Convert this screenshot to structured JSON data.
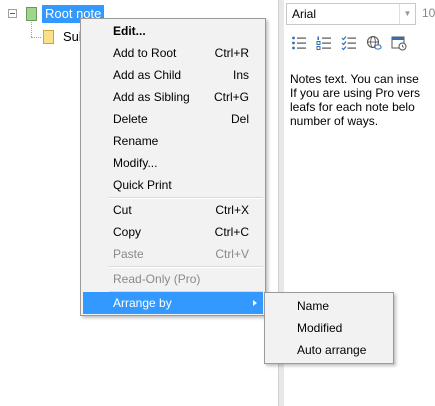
{
  "tree": {
    "nodes": [
      {
        "label": "Root note",
        "icon": "note-icon-green",
        "selected": true
      },
      {
        "label": "Sub",
        "icon": "note-icon-yellow",
        "selected": false
      }
    ]
  },
  "editor": {
    "font_name": "Arial",
    "font_size": "10",
    "toolbar_icons": [
      "bulleted-list-icon",
      "numbered-list-icon",
      "checklist-icon",
      "link-icon",
      "date-time-icon"
    ],
    "text_lines": [
      "Notes text. You can inse",
      "If you are using Pro vers",
      "leafs for each note belo",
      "number of ways."
    ]
  },
  "context_menu": {
    "items": [
      {
        "label": "Edit...",
        "shortcut": "",
        "bold": true,
        "disabled": false
      },
      {
        "label": "Add to Root",
        "shortcut": "Ctrl+R",
        "disabled": false
      },
      {
        "label": "Add as Child",
        "shortcut": "Ins",
        "disabled": false
      },
      {
        "label": "Add as Sibling",
        "shortcut": "Ctrl+G",
        "disabled": false
      },
      {
        "label": "Delete",
        "shortcut": "Del",
        "disabled": false
      },
      {
        "label": "Rename",
        "shortcut": "",
        "disabled": false
      },
      {
        "label": "Modify...",
        "shortcut": "",
        "disabled": false
      },
      {
        "label": "Quick Print",
        "shortcut": "",
        "disabled": false
      },
      {
        "label": "Cut",
        "shortcut": "Ctrl+X",
        "disabled": false
      },
      {
        "label": "Copy",
        "shortcut": "Ctrl+C",
        "disabled": false
      },
      {
        "label": "Paste",
        "shortcut": "Ctrl+V",
        "disabled": true
      },
      {
        "label": "Read-Only (Pro)",
        "shortcut": "",
        "disabled": true
      },
      {
        "label": "Arrange by",
        "shortcut": "",
        "disabled": false,
        "highlighted": true,
        "has_submenu": true
      }
    ]
  },
  "submenu": {
    "items": [
      {
        "label": "Name"
      },
      {
        "label": "Modified"
      },
      {
        "label": "Auto arrange"
      }
    ]
  },
  "colors": {
    "selection": "#3399ff",
    "menu_background": "#f2f2f2",
    "disabled_text": "#8a8a8a"
  }
}
